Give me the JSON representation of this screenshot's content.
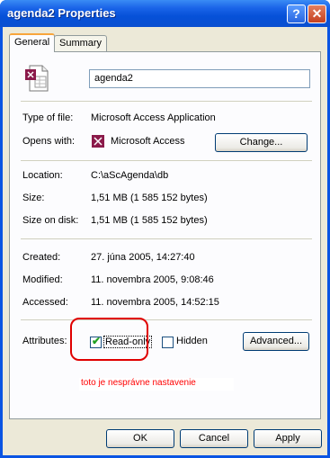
{
  "window": {
    "title": "agenda2 Properties"
  },
  "tabs": [
    "General",
    "Summary"
  ],
  "general": {
    "file_name": "agenda2",
    "type_label": "Type of file:",
    "type_value": "Microsoft Access Application",
    "opens_label": "Opens with:",
    "opens_value": "Microsoft Access",
    "change_button": "Change...",
    "location_label": "Location:",
    "location_value": "C:\\aScAgenda\\db",
    "size_label": "Size:",
    "size_value": "1,51 MB (1 585 152 bytes)",
    "size_on_disk_label": "Size on disk:",
    "size_on_disk_value": "1,51 MB (1 585 152 bytes)",
    "created_label": "Created:",
    "created_value": "27. júna 2005, 14:27:40",
    "modified_label": "Modified:",
    "modified_value": "11. novembra 2005, 9:08:46",
    "accessed_label": "Accessed:",
    "accessed_value": "11. novembra 2005, 14:52:15",
    "attributes_label": "Attributes:",
    "readonly_label": "Read-only",
    "readonly_checked": true,
    "hidden_label": "Hidden",
    "hidden_checked": false,
    "advanced_button": "Advanced..."
  },
  "annotation": {
    "note": "toto je nesprávne nastavenie",
    "color": "#ff0000"
  },
  "footer": {
    "ok": "OK",
    "cancel": "Cancel",
    "apply": "Apply"
  },
  "icons": {
    "file": "access-file-icon",
    "app": "access-app-icon",
    "help": "help-icon",
    "close": "close-icon"
  }
}
